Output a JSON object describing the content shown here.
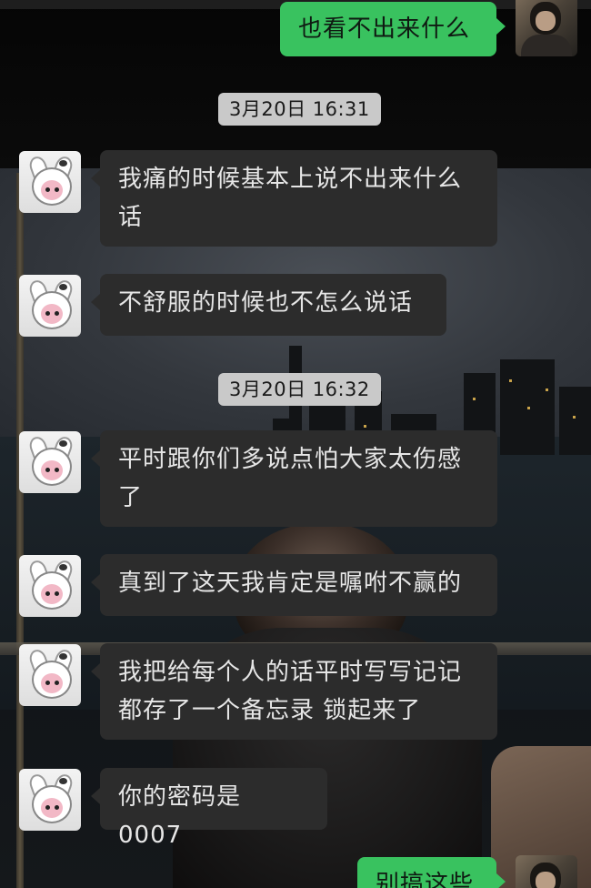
{
  "chat": {
    "messages": [
      {
        "from": "me",
        "text": "也看不出来什么"
      },
      {
        "type": "time",
        "text": "3月20日 16:31"
      },
      {
        "from": "other",
        "text": "我痛的时候基本上说不出来什么话"
      },
      {
        "from": "other",
        "text": "不舒服的时候也不怎么说话"
      },
      {
        "type": "time",
        "text": "3月20日 16:32"
      },
      {
        "from": "other",
        "text": "平时跟你们多说点怕大家太伤感了"
      },
      {
        "from": "other",
        "text": "真到了这天我肯定是嘱咐不赢的"
      },
      {
        "from": "other",
        "text": "我把给每个人的话平时写写记记都存了一个备忘录 锁起来了"
      },
      {
        "from": "other",
        "text": "你的密码是 0007"
      },
      {
        "from": "me",
        "text": "别搞这些"
      }
    ]
  },
  "colors": {
    "my_bubble": "#39c25f",
    "other_bubble": "#2c2c2c",
    "timestamp_bg": "#c9c9c9"
  },
  "icons": [
    "cartoon-avatar-icon",
    "user-photo-avatar-icon"
  ]
}
